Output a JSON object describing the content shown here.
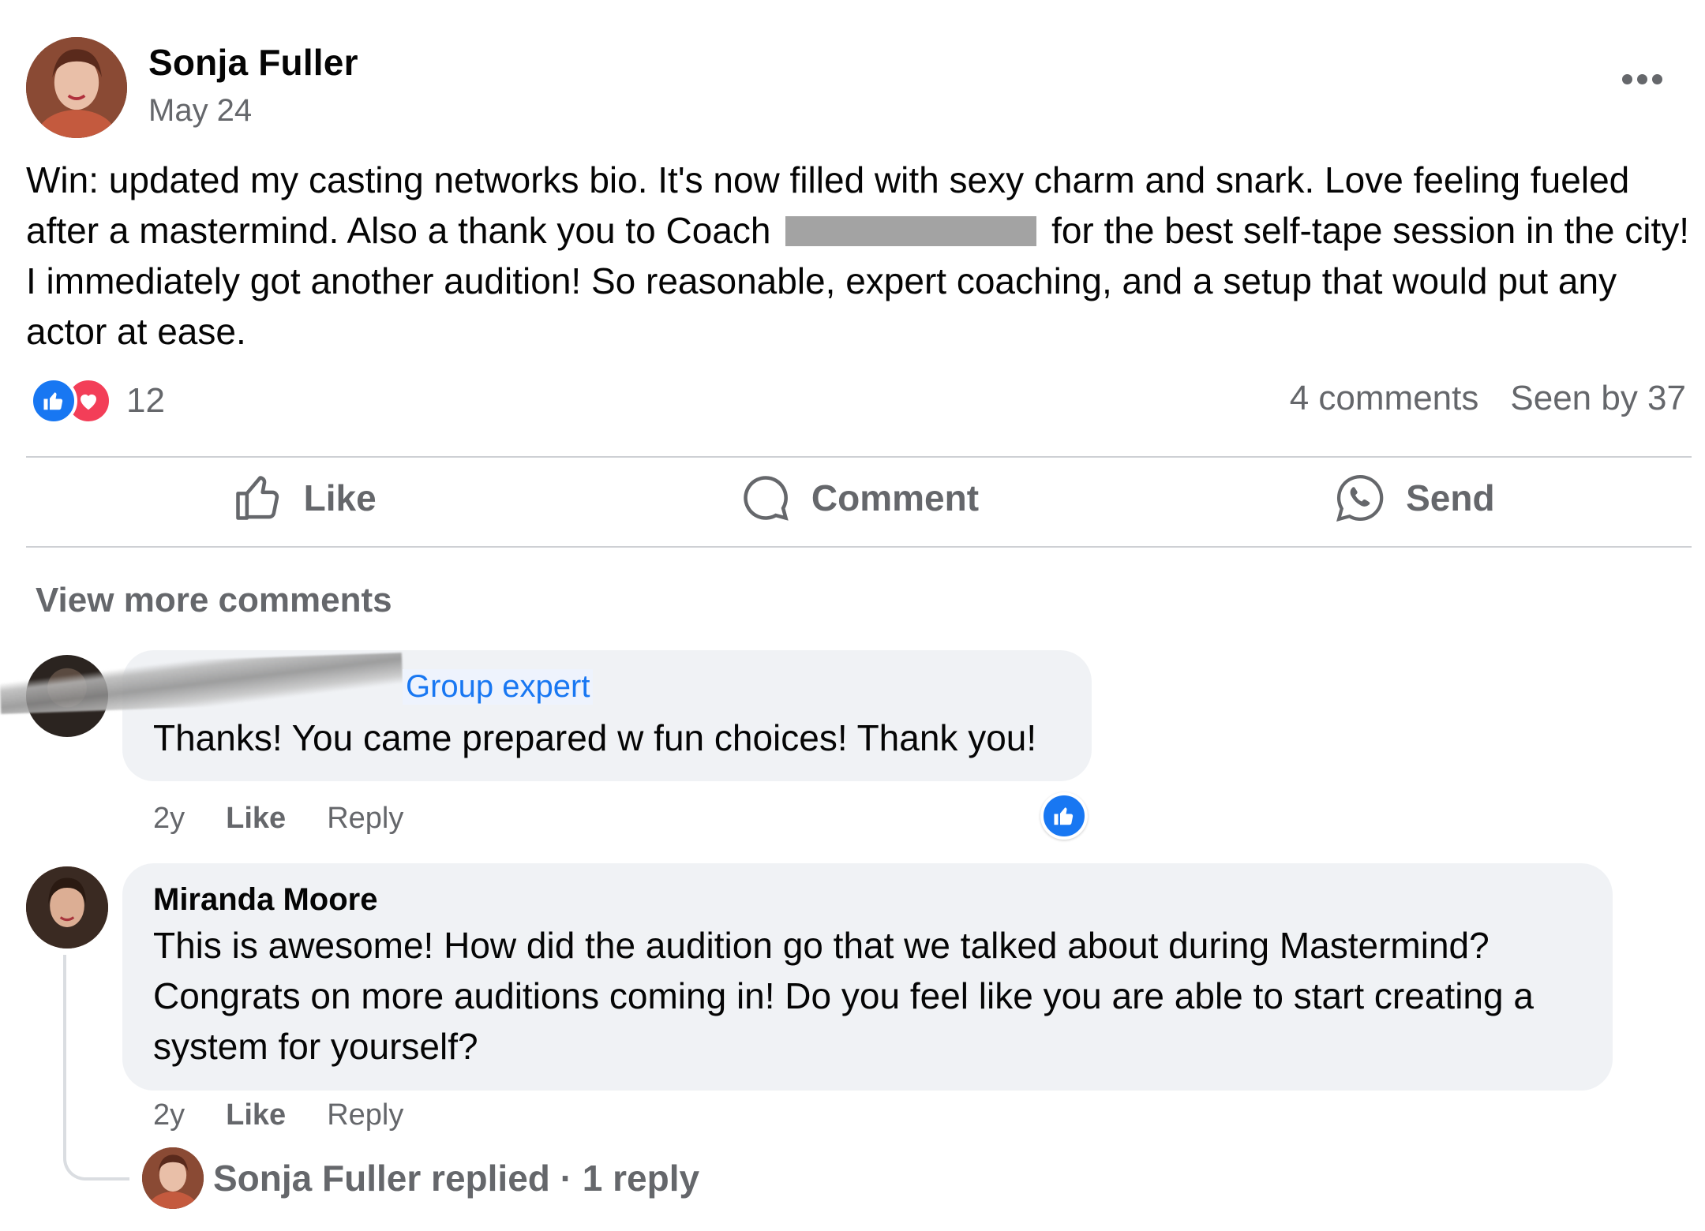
{
  "post": {
    "author": "Sonja Fuller",
    "date": "May 24",
    "body_part1": "Win: updated my casting networks bio. It's now filled with sexy charm and snark. Love feeling fueled after a mastermind. Also a thank you to Coach",
    "body_part2": "for the best self-tape session in the city! I immediately got another audition! So reasonable, expert coaching, and a setup that would put any actor at ease.",
    "reaction_count": "12",
    "comments_count": "4 comments",
    "seen_by": "Seen by 37"
  },
  "actions": {
    "like": "Like",
    "comment": "Comment",
    "send": "Send"
  },
  "view_more": "View more comments",
  "comments": [
    {
      "badge": "Group expert",
      "text": "Thanks! You came prepared w fun choices! Thank you!",
      "time": "2y",
      "like": "Like",
      "reply": "Reply"
    },
    {
      "author": "Miranda Moore",
      "text": "This is awesome! How did the audition go that we talked about during Mastermind? Congrats on more auditions coming in! Do you feel like you are able to start creating a system for yourself?",
      "time": "2y",
      "like": "Like",
      "reply": "Reply",
      "replies_summary": "Sonja Fuller replied · 1 reply"
    }
  ],
  "colors": {
    "accent": "#1877f2",
    "love": "#f33e58",
    "secondary_text": "#65676b",
    "bubble": "#f0f2f5"
  },
  "icons": [
    "more-icon",
    "like-reaction-icon",
    "love-reaction-icon",
    "thumbs-up-icon",
    "comment-icon",
    "whatsapp-icon"
  ]
}
